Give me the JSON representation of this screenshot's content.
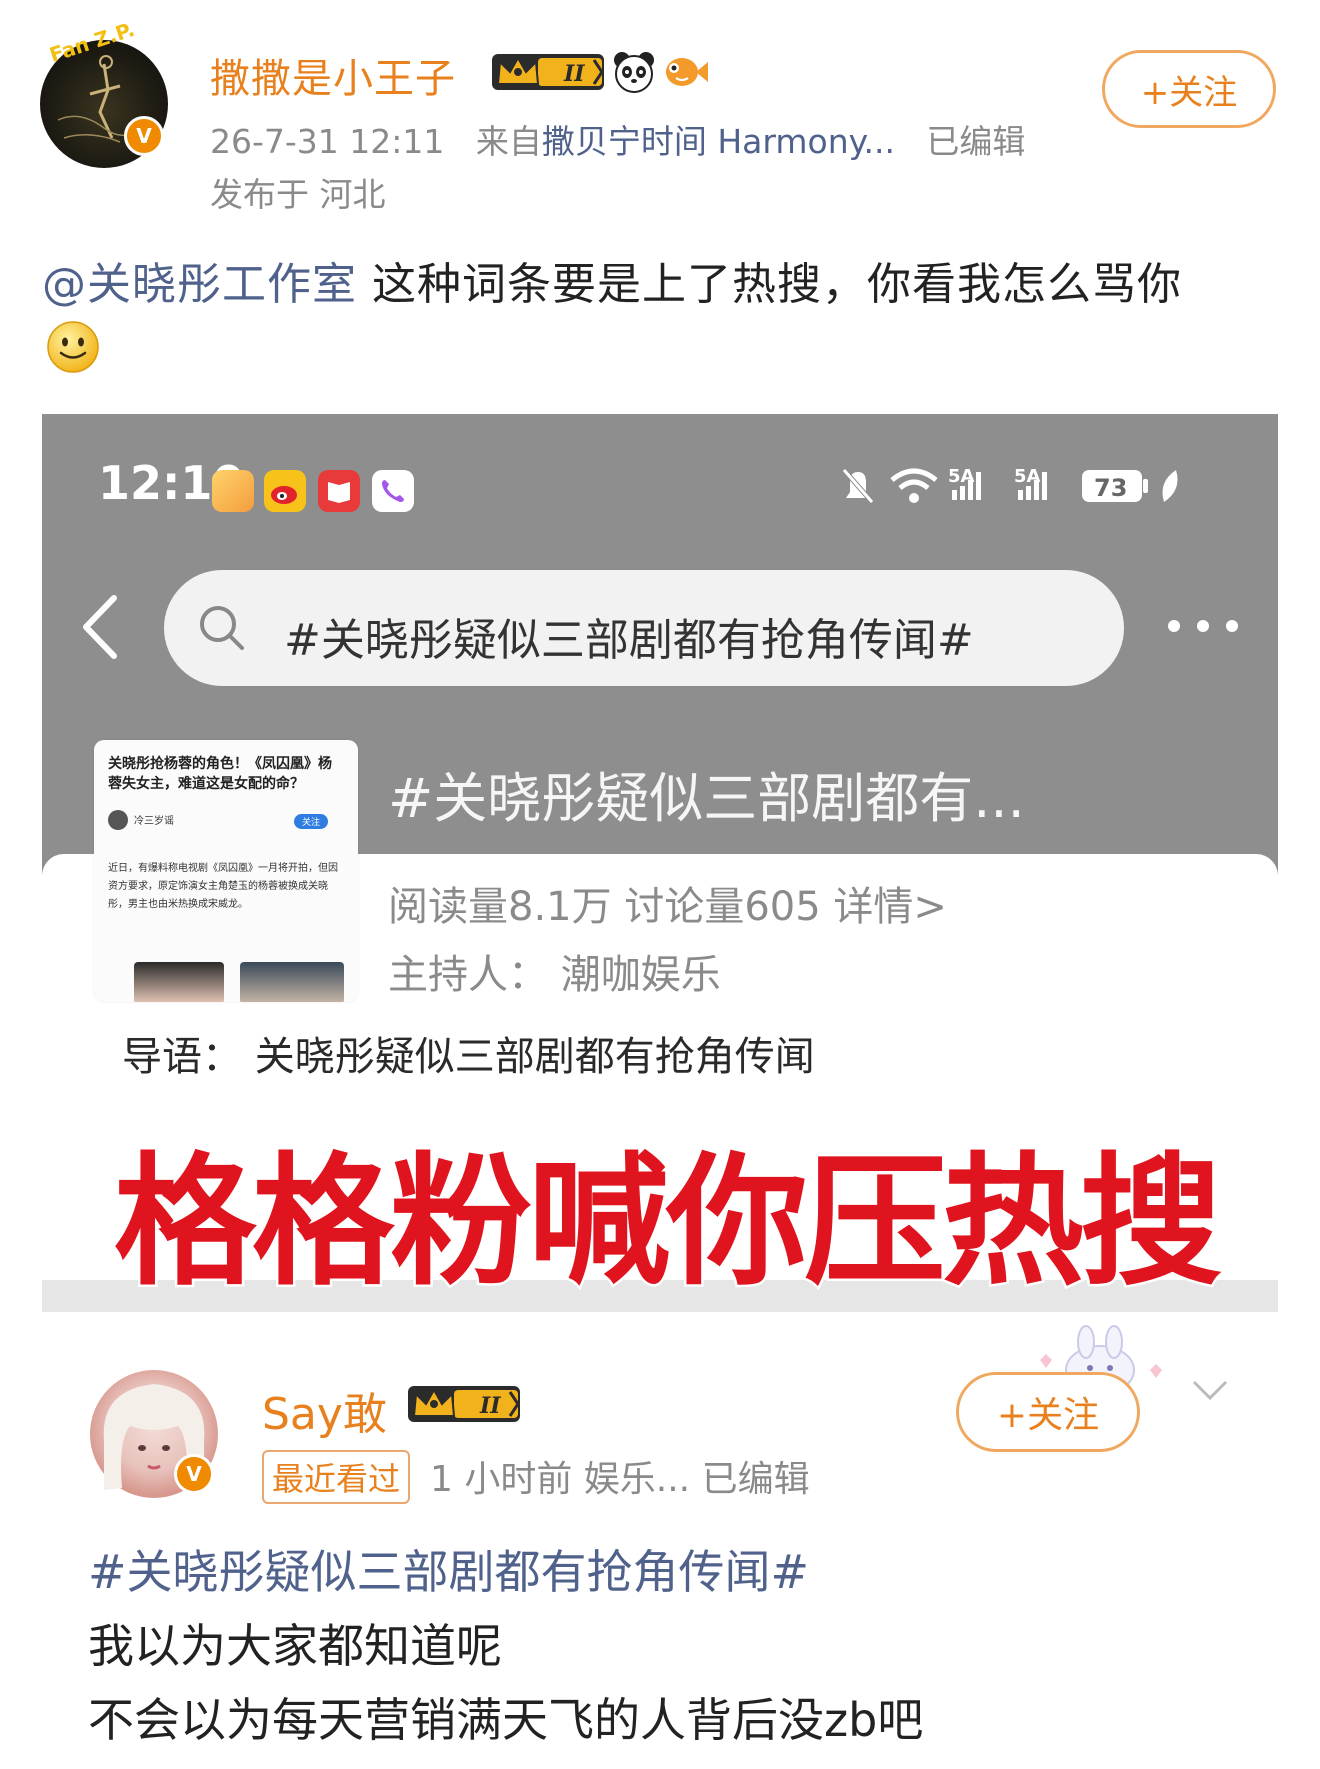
{
  "post": {
    "avatar_text": "Fan Z.P.",
    "username": "撒撒是小王子",
    "badge_level": "II",
    "verified_mark": "V",
    "timestamp": "26-7-31 12:11",
    "source_prefix": "来自",
    "source_name": "撒贝宁时间 Harmony...",
    "edited": "已编辑",
    "location": "发布于 河北",
    "follow_label": "+关注",
    "mention": "@关晓彤工作室",
    "body": " 这种词条要是上了热搜，你看我怎么骂你",
    "emoji": "smile-emoji"
  },
  "screenshot": {
    "status_time": "12:10",
    "status_signal_1": "5A",
    "status_signal_2": "5A",
    "battery": "73",
    "search_query": "#关晓彤疑似三部剧都有抢角传闻#",
    "topic_title": "#关晓彤疑似三部剧都有...",
    "thumb_headline": "关晓彤抢杨蓉的角色！《凤囚凰》杨蓉失女主，难道这是女配的命？",
    "thumb_author": "冷三岁谣",
    "thumb_follow": "关注",
    "thumb_body": "近日，有爆料称电视剧《凤囚凰》一月将开拍，但因资方要求，原定饰演女主角楚玉的杨蓉被换成关晓彤，男主也由米热换成宋威龙。",
    "reads": "阅读量8.1万  讨论量605  详情>",
    "host": "主持人：  潮咖娱乐",
    "guide": "导语：  关晓彤疑似三部剧都有抢角传闻",
    "overlay_caption": "格格粉喊你压热搜"
  },
  "quoted_post": {
    "username": "Say敢",
    "badge_level": "II",
    "verified_mark": "V",
    "follow_label": "+关注",
    "recent_tag": "最近看过",
    "meta": "1 小时前  娱乐...    已编辑",
    "topic": "#关晓彤疑似三部剧都有抢角传闻#",
    "line1": "我以为大家都知道呢",
    "line2": "不会以为每天营销满天飞的人背后没zb吧"
  },
  "colors": {
    "accent_orange": "#e8801e",
    "link_blue": "#50628c",
    "caption_red": "#e0141e",
    "meta_gray": "#8a8a8a"
  }
}
